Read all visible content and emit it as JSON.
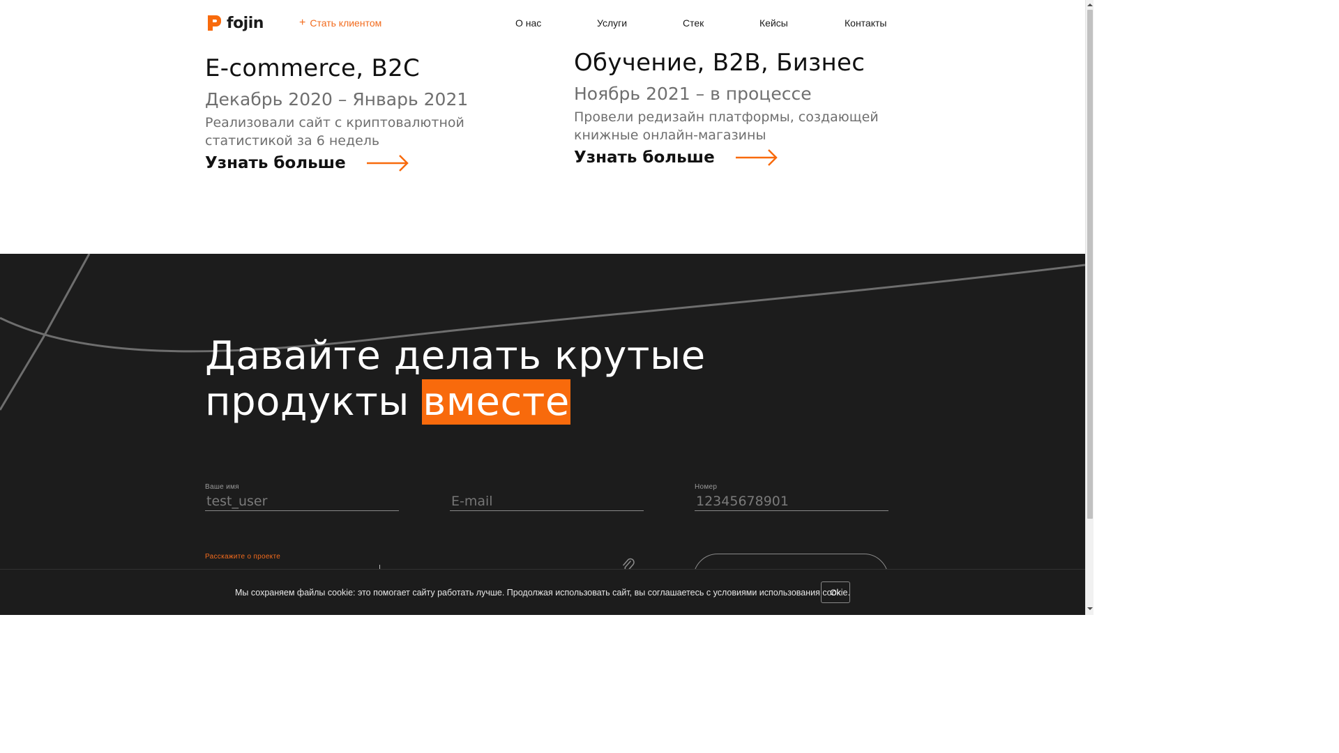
{
  "header": {
    "logo_text": "fojin",
    "become_client": "Стать клиентом",
    "nav": [
      "О нас",
      "Услуги",
      "Стек",
      "Кейсы",
      "Контакты"
    ]
  },
  "cases": [
    {
      "title": "E-commerce, B2C",
      "date": "Декабрь 2020 – Январь 2021",
      "desc_line1": "Реализовали сайт с криптовалютной",
      "desc_line2": "статистикой за 6 недель",
      "more": "Узнать больше"
    },
    {
      "title": "Обучение, B2B, Бизнес",
      "date": "Ноябрь 2021 – в процессе",
      "desc_line1": "Провели редизайн платформы, создающей",
      "desc_line2": "книжные онлайн-магазины",
      "more": "Узнать больше"
    }
  ],
  "contact": {
    "headline_line1": "Давайте делать крутые",
    "headline_line2_plain": "продукты ",
    "headline_line2_highlight": "вместе",
    "name_label": "Ваше имя",
    "name_value": "test_user",
    "email_placeholder": "E-mail",
    "phone_label": "Номер",
    "phone_value": "12345678901",
    "project_label": "Расскажите о проекте"
  },
  "cookie": {
    "text": "Мы сохраняем файлы cookie: это помогает сайту работать лучше. Продолжая использовать сайт, вы соглашаетесь с условиями использования cookie.",
    "ok": "Ok"
  },
  "colors": {
    "accent": "#f86a0c",
    "dark_bg": "#1c1c1c"
  },
  "icons": [
    "logo-mark-icon",
    "plus-icon",
    "arrow-right-icon",
    "paperclip-icon"
  ]
}
